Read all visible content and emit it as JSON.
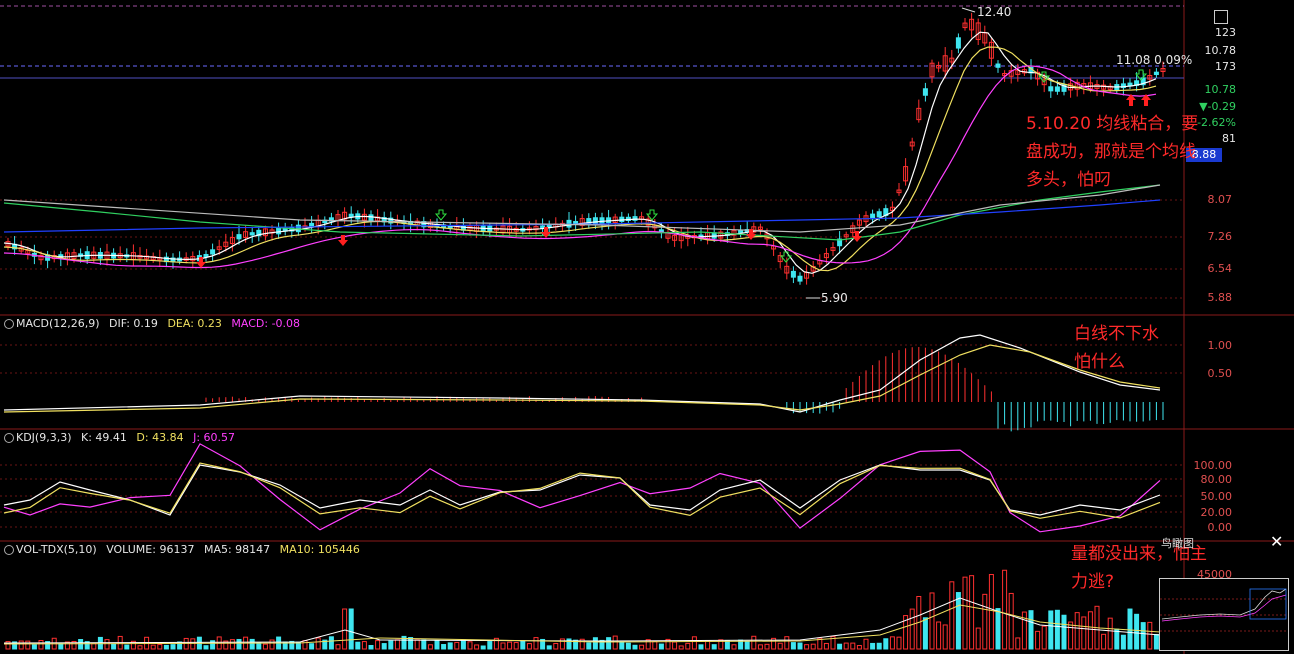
{
  "title_text": "",
  "price_axis": {
    "ticks": [
      "8.07",
      "7.26",
      "6.54",
      "5.88"
    ],
    "top_ticks": [
      "10.78",
      "173",
      "10.78"
    ],
    "change_pct": "-2.62%",
    "change_val": "▼-0.29",
    "badge": "8.88",
    "extra_nums": [
      "123",
      "81"
    ]
  },
  "main_labels": {
    "high_mark": "12.40",
    "low_mark": "5.90",
    "last_price": "11.08 0.09%"
  },
  "macd": {
    "name": "MACD(12,26,9)",
    "dif": "DIF: 0.19",
    "dea": "DEA: 0.23",
    "macd": "MACD: -0.08",
    "ticks": [
      "1.00",
      "0.50"
    ]
  },
  "kdj": {
    "name": "KDJ(9,3,3)",
    "k": "K: 49.41",
    "d": "D: 43.84",
    "j": "J: 60.57",
    "ticks": [
      "100.00",
      "80.00",
      "50.00",
      "20.00",
      "0.00"
    ]
  },
  "vol": {
    "name": "VOL-TDX(5,10)",
    "volume": "VOLUME: 96137",
    "ma5": "MA5: 98147",
    "ma10": "MA10: 105446",
    "ticks": [
      "45000"
    ]
  },
  "notes": {
    "note1_line1": "5.10.20 均线粘合，要",
    "note1_line2": "盘成功，那就是个均线",
    "note1_line3": "多头，怕叼",
    "note2_line1": "白线不下水",
    "note2_line2": "怕什么",
    "note3_line1": "量都没出来，怕主",
    "note3_line2": "力逃?"
  },
  "minimap": {
    "title": "鸟瞰图"
  },
  "colors": {
    "up": "#ff3030",
    "down": "#3fe6f0",
    "ma5": "#ffffff",
    "ma10": "#f0e060",
    "ma20": "#ff40ff",
    "ma60": "#30d060",
    "ma120": "#2040ff",
    "grid": "#8a1a1a"
  },
  "chart_data": {
    "type": "candlestick",
    "price_range": [
      5.6,
      13.0
    ],
    "summary": {
      "high": 12.4,
      "low": 5.9,
      "last": 11.08
    },
    "macd_values": {
      "dif": 0.19,
      "dea": 0.23,
      "macd": -0.08
    },
    "kdj_values": {
      "k": 49.41,
      "d": 43.84,
      "j": 60.57
    },
    "vol_values": {
      "volume": 96137,
      "ma5": 98147,
      "ma10": 105446
    }
  }
}
